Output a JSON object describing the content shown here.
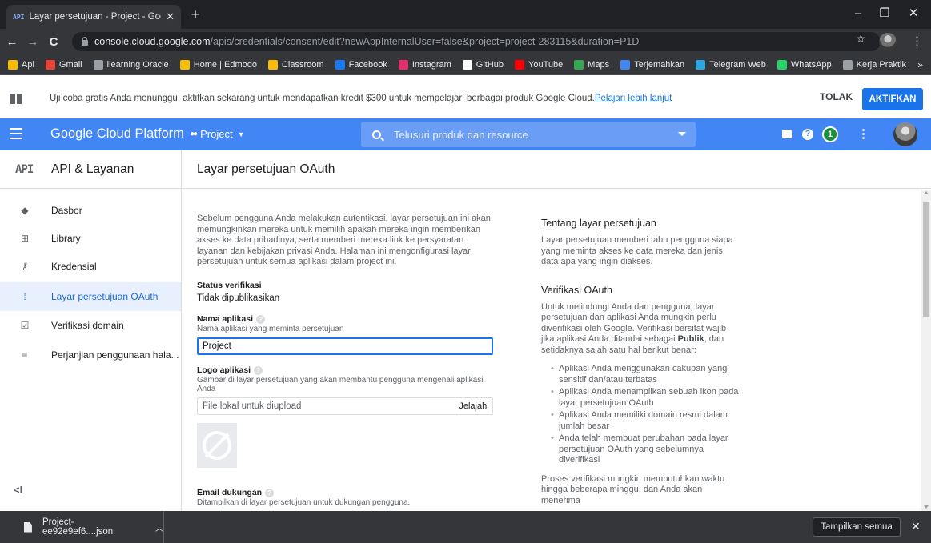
{
  "browser": {
    "tab_icon": "API",
    "tab_title": "Layar persetujuan - Project - Goo",
    "url_host": "console.cloud.google.com",
    "url_path": "/apis/credentials/consent/edit?newAppInternalUser=false&project=project-283115&duration=P1D",
    "bookmarks": [
      {
        "label": "Apl",
        "icon": "apps-grid-icon",
        "color": "#fbbc04"
      },
      {
        "label": "Gmail",
        "icon": "gmail-icon",
        "color": "#ea4335"
      },
      {
        "label": "llearning Oracle",
        "icon": "globe-icon",
        "color": "#9aa0a6"
      },
      {
        "label": "Home | Edmodo",
        "icon": "edmodo-icon",
        "color": "#fbbc04"
      },
      {
        "label": "Classroom",
        "icon": "classroom-icon",
        "color": "#fbbc04"
      },
      {
        "label": "Facebook",
        "icon": "facebook-icon",
        "color": "#1877f2"
      },
      {
        "label": "Instagram",
        "icon": "instagram-icon",
        "color": "#e1306c"
      },
      {
        "label": "GitHub",
        "icon": "github-icon",
        "color": "#ffffff"
      },
      {
        "label": "YouTube",
        "icon": "youtube-icon",
        "color": "#ff0000"
      },
      {
        "label": "Maps",
        "icon": "maps-icon",
        "color": "#34a853"
      },
      {
        "label": "Terjemahkan",
        "icon": "translate-icon",
        "color": "#4285f4"
      },
      {
        "label": "Telegram Web",
        "icon": "telegram-icon",
        "color": "#2ca5e0"
      },
      {
        "label": "WhatsApp",
        "icon": "whatsapp-icon",
        "color": "#25d366"
      },
      {
        "label": "Kerja Praktik",
        "icon": "globe-icon",
        "color": "#9aa0a6"
      }
    ],
    "bookmarks_more": "»"
  },
  "banner": {
    "text": "Uji coba gratis Anda menunggu: aktifkan sekarang untuk mendapatkan kredit $300 untuk mempelajari berbagai produk Google Cloud.",
    "link": "Pelajari lebih lanjut",
    "dismiss": "TOLAK",
    "activate": "AKTIFKAN"
  },
  "header": {
    "title": "Google Cloud Platform",
    "project": "Project",
    "search_placeholder": "Telusuri produk dan resource",
    "notification_count": "1"
  },
  "section": {
    "logo": "API",
    "title": "API & Layanan",
    "page_title": "Layar persetujuan OAuth"
  },
  "sidebar": {
    "items": [
      {
        "label": "Dasbor",
        "icon": "◆"
      },
      {
        "label": "Library",
        "icon": "⊞"
      },
      {
        "label": "Kredensial",
        "icon": "⚷"
      },
      {
        "label": "Layar persetujuan OAuth",
        "icon": "⁞"
      },
      {
        "label": "Verifikasi domain",
        "icon": "☑"
      },
      {
        "label": "Perjanjian penggunaan hala...",
        "icon": "≡"
      }
    ],
    "collapse": "<I"
  },
  "form": {
    "intro": "Sebelum pengguna Anda melakukan autentikasi, layar persetujuan ini akan memungkinkan mereka untuk memilih apakah mereka ingin memberikan akses ke data pribadinya, serta memberi mereka link ke persyaratan layanan dan kebijakan privasi Anda. Halaman ini mengonfigurasi layar persetujuan untuk semua aplikasi dalam project ini.",
    "status_label": "Status verifikasi",
    "status_value": "Tidak dipublikasikan",
    "app_name_label": "Nama aplikasi",
    "app_name_help": "Nama aplikasi yang meminta persetujuan",
    "app_name_value": "Project",
    "logo_label": "Logo aplikasi",
    "logo_help": "Gambar di layar persetujuan yang akan membantu pengguna mengenali aplikasi Anda",
    "file_placeholder": "File lokal untuk diupload",
    "browse": "Jelajahi",
    "email_label": "Email dukungan",
    "email_help": "Ditampilkan di layar persetujuan untuk dukungan pengguna."
  },
  "info": {
    "about_title": "Tentang layar persetujuan",
    "about_text": "Layar persetujuan memberi tahu pengguna siapa yang meminta akses ke data mereka dan jenis data apa yang ingin diakses.",
    "verify_title": "Verifikasi OAuth",
    "verify_text_1": "Untuk melindungi Anda dan pengguna, layar persetujuan dan aplikasi Anda mungkin perlu diverifikasi oleh Google. Verifikasi bersifat wajib jika aplikasi Anda ditandai sebagai ",
    "verify_bold": "Publik",
    "verify_text_2": ", dan setidaknya salah satu hal berikut benar:",
    "bullets": [
      "Aplikasi Anda menggunakan cakupan yang sensitif dan/atau terbatas",
      "Aplikasi Anda menampilkan sebuah ikon pada layar persetujuan OAuth",
      "Aplikasi Anda memiliki domain resmi dalam jumlah besar",
      "Anda telah membuat perubahan pada layar persetujuan OAuth yang sebelumnya diverifikasi"
    ],
    "process_text": "Proses verifikasi mungkin membutuhkan waktu hingga beberapa minggu, dan Anda akan menerima"
  },
  "download": {
    "file": "Project-ee92e9ef6....json",
    "show_all": "Tampilkan semua"
  },
  "colors": {
    "header_blue": "#4285f4",
    "accent": "#1a73e8",
    "active_bg": "#e8f0fe"
  }
}
